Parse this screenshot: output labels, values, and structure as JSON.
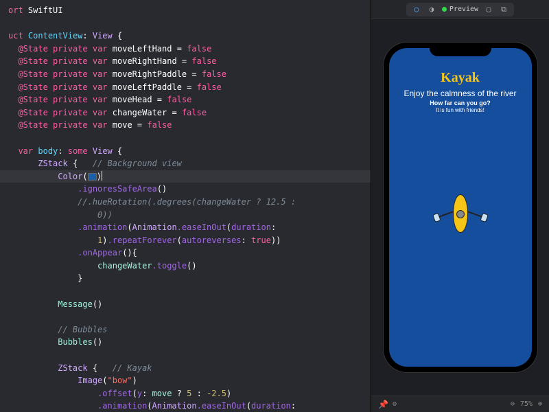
{
  "code": {
    "import_kw": "ort",
    "swiftui": "SwiftUI",
    "struct_kw": "uct",
    "content_view": "ContentView",
    "view_proto": "View",
    "state": "@State",
    "private": "private",
    "var": "var",
    "eq_false": " = ",
    "false": "false",
    "vars": {
      "v1": "moveLeftHand",
      "v2": "moveRightHand",
      "v3": "moveRightPaddle",
      "v4": "moveLeftPaddle",
      "v5": "moveHead",
      "v6": "changeWater",
      "v7": "move"
    },
    "body": "body",
    "some": "some",
    "zstack": "ZStack",
    "bg_comment": "// Background view",
    "color": "Color",
    "ignores": ".ignoresSafeArea",
    "hue_comment": "//.hueRotation(.degrees(changeWater ? 12.5 :",
    "hue_comment2": "0))",
    "animation": ".animation",
    "anim_type": "Animation",
    "easeinout": ".easeInOut",
    "duration_lbl": "duration",
    "duration_val": "1",
    "repeat": ".repeatForever",
    "autoreverses_lbl": "autoreverses",
    "true": "true",
    "onappear": ".onAppear",
    "changewater": "changeWater",
    "toggle": ".toggle",
    "message": "Message",
    "bubbles_comment": "// Bubbles",
    "bubbles": "Bubbles",
    "kayak_comment": "// Kayak",
    "image": "Image",
    "bow_str": "\"bow\"",
    "offset": ".offset",
    "y_lbl": "y",
    "move_var": "move",
    "val5": "5",
    "valn25": "-2.5",
    "animation2": ".animation",
    "duration_lbl2": "duration"
  },
  "preview": {
    "label": "Preview",
    "app_title": "Kayak",
    "subtitle1": "Enjoy the calmness of the river",
    "subtitle2": "How far can you go?",
    "subtitle3": "It is fun with friends!"
  },
  "bottombar": {
    "zoom": "75%"
  }
}
